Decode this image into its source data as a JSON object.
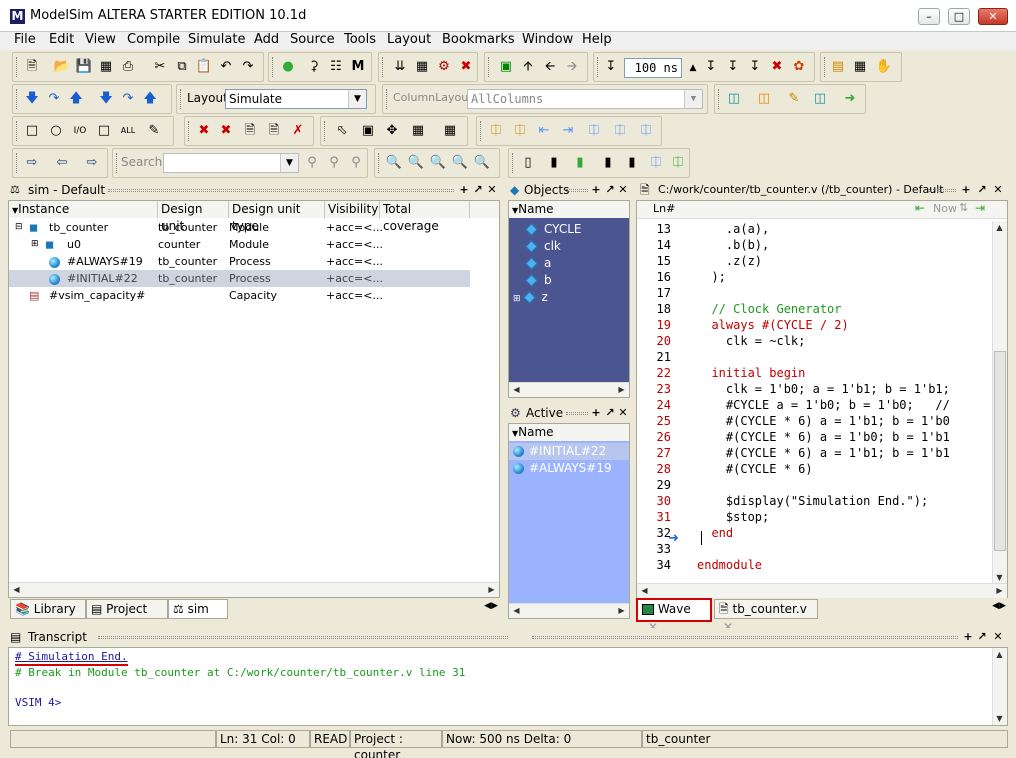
{
  "window": {
    "title": "ModelSim ALTERA STARTER EDITION 10.1d"
  },
  "menu": [
    "File",
    "Edit",
    "View",
    "Compile",
    "Simulate",
    "Add",
    "Source",
    "Tools",
    "Layout",
    "Bookmarks",
    "Window",
    "Help"
  ],
  "toolbar": {
    "run_length": "100 ns",
    "layout_label": "Layout",
    "layout_value": "Simulate",
    "column_layout_label": "ColumnLayout",
    "column_layout_value": "AllColumns",
    "search_label": "Search:",
    "search_value": ""
  },
  "sim_panel": {
    "title": "sim - Default",
    "columns": [
      "Instance",
      "Design unit",
      "Design unit type",
      "Visibility",
      "Total coverage"
    ],
    "rows": [
      {
        "instance": "tb_counter",
        "unit": "tb_counter",
        "type": "Module",
        "visibility": "+acc=<..."
      },
      {
        "instance": "u0",
        "unit": "counter",
        "type": "Module",
        "visibility": "+acc=<..."
      },
      {
        "instance": "#ALWAYS#19",
        "unit": "tb_counter",
        "type": "Process",
        "visibility": "+acc=<..."
      },
      {
        "instance": "#INITIAL#22",
        "unit": "tb_counter",
        "type": "Process",
        "visibility": "+acc=<..."
      },
      {
        "instance": "#vsim_capacity#",
        "unit": "",
        "type": "Capacity",
        "visibility": "+acc=<..."
      }
    ],
    "tabs": [
      "Library",
      "Project",
      "sim"
    ]
  },
  "objects_panel": {
    "title": "Objects",
    "column": "Name",
    "items": [
      "CYCLE",
      "clk",
      "a",
      "b",
      "z"
    ]
  },
  "active_panel": {
    "title": "Active",
    "column": "Name",
    "items": [
      "#INITIAL#22",
      "#ALWAYS#19"
    ]
  },
  "source_panel": {
    "title": "C:/work/counter/tb_counter.v (/tb_counter) - Default",
    "col_label": "Ln#",
    "now_label": "Now",
    "lines": [
      {
        "n": "13",
        "text": "    .a(a),"
      },
      {
        "n": "14",
        "text": "    .b(b),"
      },
      {
        "n": "15",
        "text": "    .z(z)"
      },
      {
        "n": "16",
        "text": "  );"
      },
      {
        "n": "17",
        "text": ""
      },
      {
        "n": "18",
        "text": "  // Clock Generator"
      },
      {
        "n": "19",
        "text": "  always #(CYCLE / 2)"
      },
      {
        "n": "20",
        "text": "    clk = ~clk;"
      },
      {
        "n": "21",
        "text": ""
      },
      {
        "n": "22",
        "text": "  initial begin"
      },
      {
        "n": "23",
        "text": "    clk = 1'b0; a = 1'b1; b = 1'b1;"
      },
      {
        "n": "24",
        "text": "    #CYCLE a = 1'b0; b = 1'b0;   //"
      },
      {
        "n": "25",
        "text": "    #(CYCLE * 6) a = 1'b1; b = 1'b0"
      },
      {
        "n": "26",
        "text": "    #(CYCLE * 6) a = 1'b0; b = 1'b1"
      },
      {
        "n": "27",
        "text": "    #(CYCLE * 6) a = 1'b1; b = 1'b1"
      },
      {
        "n": "28",
        "text": "    #(CYCLE * 6)"
      },
      {
        "n": "29",
        "text": ""
      },
      {
        "n": "30",
        "text": "    $display(\"Simulation End.\");"
      },
      {
        "n": "31",
        "text": "    $stop;"
      },
      {
        "n": "32",
        "text": "  end"
      },
      {
        "n": "33",
        "text": ""
      },
      {
        "n": "34",
        "text": "endmodule"
      }
    ],
    "tabs": [
      "Wave",
      "tb_counter.v"
    ]
  },
  "transcript": {
    "title": "Transcript",
    "lines": [
      "# Simulation End.",
      "# Break in Module tb_counter at C:/work/counter/tb_counter.v line 31",
      "",
      "VSIM 4>"
    ]
  },
  "statusbar": {
    "ln_col": "Ln:   31 Col:  0",
    "mode": "READ",
    "project": "Project : counter",
    "now_delta": "Now: 500 ns  Delta: 0",
    "context": "tb_counter"
  },
  "colors": {
    "highlight_tab_border": "#d40000",
    "comment": "#1a9a1a",
    "keyword": "#c00000",
    "string": "#1a9a1a"
  }
}
